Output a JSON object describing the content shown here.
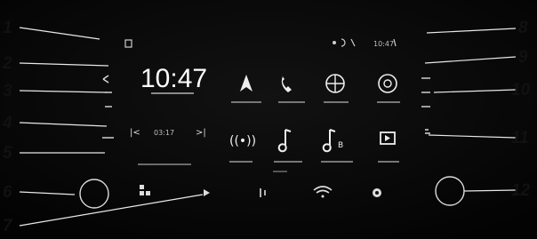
{
  "status_bar": {
    "time": "10:47"
  },
  "clock": {
    "time": "10:47"
  },
  "media": {
    "track_time": "03:17"
  },
  "callouts": [
    "1",
    "2",
    "3",
    "4",
    "5",
    "6",
    "7",
    "8",
    "9",
    "10",
    "11",
    "12"
  ]
}
